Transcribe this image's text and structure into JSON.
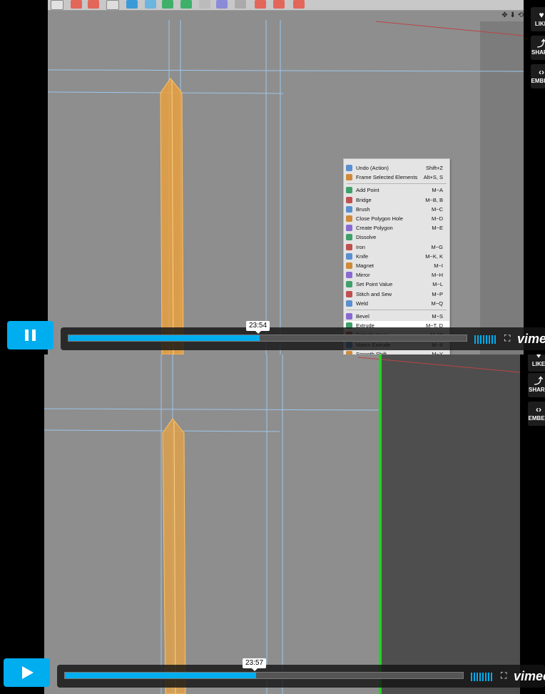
{
  "side_buttons": [
    "LIKE",
    "SHARE",
    "EMBED"
  ],
  "context_menu": {
    "items": [
      {
        "label": "Undo (Action)",
        "shortcut": "Shift+Z",
        "icon": "undo-icon"
      },
      {
        "label": "Frame Selected Elements",
        "shortcut": "Alt+S, S",
        "icon": "frame-icon"
      },
      {
        "sep": true
      },
      {
        "label": "Add Point",
        "shortcut": "M~A",
        "icon": "add-point-icon"
      },
      {
        "label": "Bridge",
        "shortcut": "M~B, B",
        "icon": "bridge-icon"
      },
      {
        "label": "Brush",
        "shortcut": "M~C",
        "icon": "brush-icon"
      },
      {
        "label": "Close Polygon Hole",
        "shortcut": "M~D",
        "icon": "close-hole-icon"
      },
      {
        "label": "Create Polygon",
        "shortcut": "M~E",
        "icon": "create-polygon-icon"
      },
      {
        "label": "Dissolve",
        "shortcut": "",
        "icon": "dissolve-icon"
      },
      {
        "label": "Iron",
        "shortcut": "M~G",
        "icon": "iron-icon"
      },
      {
        "label": "Knife",
        "shortcut": "M~K, K",
        "icon": "knife-icon"
      },
      {
        "label": "Magnet",
        "shortcut": "M~I",
        "icon": "magnet-icon"
      },
      {
        "label": "Mirror",
        "shortcut": "M~H",
        "icon": "mirror-icon"
      },
      {
        "label": "Set Point Value",
        "shortcut": "M~L",
        "icon": "set-point-icon"
      },
      {
        "label": "Stitch and Sew",
        "shortcut": "M~P",
        "icon": "stitch-icon"
      },
      {
        "label": "Weld",
        "shortcut": "M~Q",
        "icon": "weld-icon"
      },
      {
        "sep": true
      },
      {
        "label": "Bevel",
        "shortcut": "M~S",
        "icon": "bevel-icon"
      },
      {
        "label": "Extrude",
        "shortcut": "M~T, D",
        "icon": "extrude-icon",
        "highlight": true
      },
      {
        "label": "Extrude Inner",
        "shortcut": "M~W",
        "icon": "extrude-inner-icon"
      },
      {
        "label": "Matrix Extrude",
        "shortcut": "M~X",
        "icon": "matrix-extrude-icon"
      },
      {
        "label": "Smooth Shift",
        "shortcut": "M~Y",
        "icon": "smooth-shift-icon"
      }
    ]
  },
  "player_top": {
    "state": "playing",
    "time_tooltip": "23:54",
    "progress": 0.48
  },
  "player_bottom": {
    "state": "paused",
    "time_tooltip": "23:57",
    "progress": 0.48
  },
  "brand": "vimeo",
  "colors": {
    "accent": "#00adef",
    "viewport": "#8e8e8e",
    "selected_polygon": "#e8a040",
    "edge_lines": "#9ec6ea",
    "green_line": "#1fd41f"
  }
}
